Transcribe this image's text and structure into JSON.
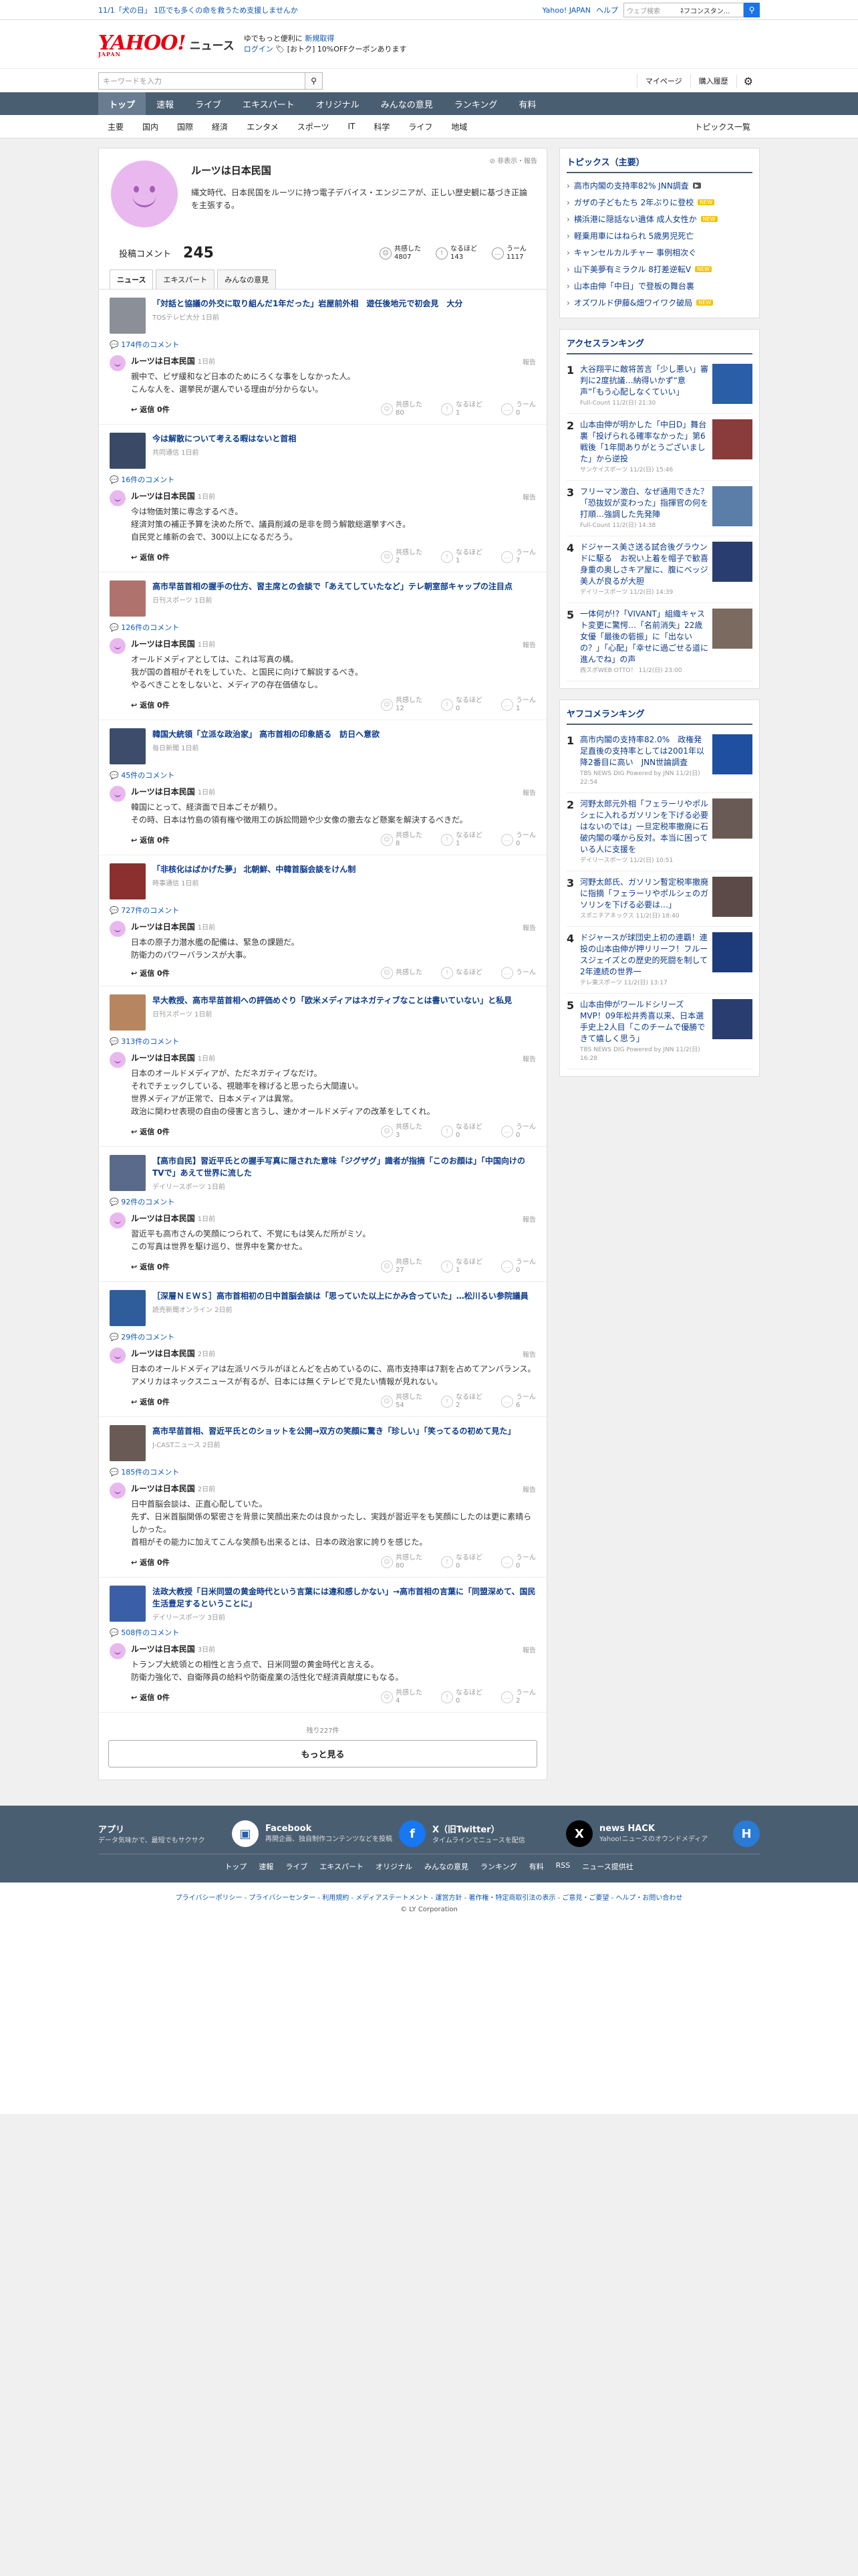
{
  "topstrip": {
    "notice": "11/1「犬の日」 1匹でも多くの命を救うため支援しませんか",
    "links": [
      "Yahoo! JAPAN",
      "ヘルプ"
    ],
    "search_placeholder": "ウェブ検索",
    "search_keyword": "ﾈフコンスタン..."
  },
  "header": {
    "logo_text": "YAHOO!",
    "logo_sub": "JAPAN",
    "section": "ニュース",
    "promo_line1": "ゆでもっと便利に",
    "promo_line1_link": "新規取得",
    "promo_line2_link": "ログイン",
    "promo_line2_text": "[おトク] 10%OFFクーポンあります"
  },
  "searchbar": {
    "placeholder": "キーワードを入力",
    "util": [
      "マイページ",
      "購入履歴"
    ]
  },
  "nav": [
    "トップ",
    "速報",
    "ライブ",
    "エキスパート",
    "オリジナル",
    "みんなの意見",
    "ランキング",
    "有料"
  ],
  "subnav": {
    "items": [
      "主要",
      "国内",
      "国際",
      "経済",
      "エンタメ",
      "スポーツ",
      "IT",
      "科学",
      "ライフ",
      "地域"
    ],
    "topics": "トピックス一覧"
  },
  "profile": {
    "name": "ルーツは日本民国",
    "bio": "縄文時代、日本民国をルーツに持つ電子デバイス・エンジニアが、正しい歴史観に基づき正論を主張する。",
    "report": "非表示・報告",
    "comment_label": "投稿コメント",
    "comment_count": "245",
    "reactions": [
      {
        "label": "共感した",
        "value": "4807"
      },
      {
        "label": "なるほど",
        "value": "143"
      },
      {
        "label": "うーん",
        "value": "1117"
      }
    ],
    "tabs": [
      "ニュース",
      "エキスパート",
      "みんなの意見"
    ]
  },
  "comments": [
    {
      "title": "「対話と協議の外交に取り組んだ1年だった」岩屋前外相　遊任後地元で初会見　大分",
      "source": "TOSテレビ大分 1日前",
      "count": "174件のコメント",
      "name": "ルーツは日本民国",
      "time": "1日前",
      "text": "親中で、ビザ緩和など日本のためにろくな事をしなかった人。\nこんな人を、選挙民が選んでいる理由が分からない。",
      "r": [
        "80",
        "1",
        "0"
      ]
    },
    {
      "title": "今は解散について考える暇はないと首相",
      "source": "共同通信 1日前",
      "count": "16件のコメント",
      "name": "ルーツは日本民国",
      "time": "1日前",
      "text": "今は物価対策に専念するべき。\n経済対策の補正予算を決めた所で、議員削減の是非を問う解散総選挙すべき。\n自民党と維新の会で、300以上になるだろう。",
      "r": [
        "2",
        "1",
        "7"
      ]
    },
    {
      "title": "高市早苗首相の握手の仕方、習主席との会談で「あえてしていたなど」テレ朝室部キャップの注目点",
      "source": "日刊スポーツ 1日前",
      "count": "126件のコメント",
      "name": "ルーツは日本民国",
      "time": "1日前",
      "text": "オールドメディアとしては、これは写真の構。\n我が国の首相がそれをしていた、と国民に向けて解説するべき。\nやるべきことをしないと、メディアの存在価値なし。",
      "r": [
        "12",
        "0",
        "1"
      ]
    },
    {
      "title": "韓国大統領「立派な政治家」 高市首相の印象語る　訪日へ意欲",
      "source": "毎日新聞 1日前",
      "count": "45件のコメント",
      "name": "ルーツは日本民国",
      "time": "1日前",
      "text": "韓国にとって、経済面で日本ごそが頼り。\nその時、日本は竹島の領有権や徴用工の訴訟問題や少女像の撤去など懸案を解決するべきだ。",
      "r": [
        "8",
        "1",
        "0"
      ]
    },
    {
      "title": "「非核化はばかげた夢」 北朝鮮、中韓首脳会談をけん制",
      "source": "時事通信 1日前",
      "count": "727件のコメント",
      "name": "ルーツは日本民国",
      "time": "1日前",
      "text": "日本の原子力潜水艦の配備は、緊急の課題だ。\n防衛力のパワーバランスが大事。",
      "r": [
        "",
        "",
        ""
      ]
    },
    {
      "title": "早大教授、高市早苗首相への評価めぐり「欧米メディアはネガティブなことは書いていない」と私見",
      "source": "日刊スポーツ 1日前",
      "count": "313件のコメント",
      "name": "ルーツは日本民国",
      "time": "1日前",
      "text": "日本のオールドメディアが、ただネガティブなだけ。\nそれでチェックしている、視聴率を稼げると思ったら大間違い。\n世界メディアが正常で、日本メディアは異常。\n政治に関わせ表現の自由の侵害と言うし、速かオールドメディアの改革をしてくれ。",
      "r": [
        "3",
        "0",
        "0"
      ]
    },
    {
      "title": "【高市自民】習近平氏との握手写真に隠された意味「ジグザグ」識者が指摘「このお顔は」「中国向けのTVで」あえて世界に流した",
      "source": "デイリースポーツ 1日前",
      "count": "92件のコメント",
      "name": "ルーツは日本民国",
      "time": "1日前",
      "text": "習近平も高市さんの笑顔につられて、不覚にもは笑んだ所がミソ。\nこの写真は世界を駆け巡り、世界中を驚かせた。",
      "r": [
        "27",
        "1",
        "0"
      ]
    },
    {
      "title": "［深層ＮＥＷＳ］高市首相初の日中首脳会談は「思っていた以上にかみ合っていた」…松川るい参院議員",
      "source": "読売新聞オンライン 2日前",
      "count": "29件のコメント",
      "name": "ルーツは日本民国",
      "time": "2日前",
      "text": "日本のオールドメディアは左派リベラルがほとんどを占めているのに、高市支持率は7割を占めてアンバランス。\nアメリカはネックスニュースが有るが、日本には無くテレビで見たい情報が見れない。",
      "r": [
        "54",
        "2",
        "6"
      ]
    },
    {
      "title": "高市早苗首相、習近平氏とのショットを公開→双方の笑顔に驚き「珍しい」「笑ってるの初めて見た」",
      "source": "J-CASTニュース 2日前",
      "count": "185件のコメント",
      "name": "ルーツは日本民国",
      "time": "2日前",
      "text": "日中首脳会談は、正直心配していた。\n先ず、日米首脳関係の緊密さを背景に笑顔出来たのは良かったし、実践が習近平をも笑顔にしたのは更に素晴らしかった。\n首相がその能力に加えてこんな笑顔も出来るとは、日本の政治家に誇りを感じた。",
      "r": [
        "80",
        "0",
        "0"
      ]
    },
    {
      "title": "法政大教授「日米同盟の黄金時代という言葉には違和感しかない」→高市首相の言葉に「同盟深めて、国民生活豊足するということに」",
      "source": "デイリースポーツ 3日前",
      "count": "508件のコメント",
      "name": "ルーツは日本民国",
      "time": "3日前",
      "text": "トランプ大統領との相性と言う点で、日米同盟の黄金時代と言える。\n防衛力強化で、自衛隊員の給料や防衛産業の活性化で経済貢献度にもなる。",
      "r": [
        "4",
        "0",
        "2"
      ]
    }
  ],
  "labels": {
    "reply": "返信 0件",
    "report": "報告",
    "react": [
      "共感した",
      "なるほど",
      "うーん"
    ]
  },
  "more": {
    "rest": "残り227件",
    "button": "もっと見る"
  },
  "sidebar": {
    "topics_title": "トピックス（主要）",
    "topics": [
      {
        "text": "高市内閣の支持率82% JNN調査",
        "tag": "v"
      },
      {
        "text": "ガザの子どもたち 2年ぶりに登校",
        "tag": "new"
      },
      {
        "text": "横浜港に隠話ない遺体 成人女性か",
        "tag": "new"
      },
      {
        "text": "軽乗用車にはねられ 5歳男児死亡",
        "tag": ""
      },
      {
        "text": "キャンセルカルチャー 事例相次ぐ",
        "tag": ""
      },
      {
        "text": "山下美夢有ミラクル 8打差逆転V",
        "tag": "new"
      },
      {
        "text": "山本由伸「中日」で登板の舞台裏",
        "tag": ""
      },
      {
        "text": "オズワルド伊藤&畑ワイワク破局",
        "tag": "new"
      }
    ],
    "access_title": "アクセスランキング",
    "access": [
      {
        "t": "大谷翔平に敵将苦言「少し悪い」審判に2度抗議…納得いかず“意声”「もう心配しなくていい」",
        "s": "Full-Count 11/2(日) 21:30"
      },
      {
        "t": "山本由伸が明かした「中日D」舞台裏「投げられる確率なかった」第6戦後「1年間ありがとうございました」から逆投",
        "s": "サンケイスポーツ 11/2(日) 15:46"
      },
      {
        "t": "フリーマン激白、なぜ通用できた？「恐抜奴が変わった」指揮官の何を打順…強調した先発陣",
        "s": "Full-Count 11/2(日) 14:38"
      },
      {
        "t": "ドジャース美さ送る試合後グラウンドに駆る　お祝い上着を帽子で歓喜　身重の奥しさキア屋に、腹にベッジ美人が良るが大胆",
        "s": "デイリースポーツ 11/2(日) 14:39"
      },
      {
        "t": "一体何が!?「VIVANT」組織キャスト変更に驚愕…「名前消失」22歳女優「最後の砦振」に「出ないの？」「心配」「幸せに過ごせる道に進んでね」の声",
        "s": "西スポWEB OTTO！ 11/2(日) 23:00"
      }
    ],
    "yafoko_title": "ヤフコメランキング",
    "yafoko": [
      {
        "t": "高市内閣の支持率82.0%　政権発足直後の支持率としては2001年以降2番目に高い　JNN世論調査",
        "s": "TBS NEWS DIG Powered by JNN 11/2(日) 22:54"
      },
      {
        "t": "河野太郎元外相「フェラーリやポルシェに入れるガソリンを下げる必要はないのでは」一旦定税率撤廃に石破内閣の嘆から反対。本当に困っている人に支援を",
        "s": "デイリースポーツ 11/2(日) 10:51"
      },
      {
        "t": "河野太郎氏、ガソリン暫定税率撤廃に指摘「フェラーリやポルシェのガソリンを下げる必要は…」",
        "s": "スポニチアネックス 11/2(日) 18:40"
      },
      {
        "t": "ドジャースが球団史上初の連覇！連投の山本由伸が押リリーフ！フルースジェイズとの歴史的死闘を制して2年連続の世界一",
        "s": "テレ東スポーツ 11/2(日) 13:17"
      },
      {
        "t": "山本由伸がワールドシリーズMVP！09年松井秀喜以来、日本選手史上2人目「このチームで優勝できて嬉しく思う」",
        "s": "TBS NEWS DIG Powered by JNN 11/2(日) 16:28"
      }
    ]
  },
  "footer": {
    "cards": [
      {
        "title": "アプリ",
        "desc": "データ気味かで、最短でもサクサク",
        "icon": "▣"
      },
      {
        "title": "Facebook",
        "desc": "再開企画、独自制作コンテンツなどを投稿",
        "icon": "f"
      },
      {
        "title": "X（旧Twitter）",
        "desc": "タイムラインでニュースを配信",
        "icon": "X"
      },
      {
        "title": "news HACK",
        "desc": "Yahoo!ニュースのオウンドメディア",
        "icon": "H"
      }
    ],
    "nav": [
      "トップ",
      "速報",
      "ライブ",
      "エキスパート",
      "オリジナル",
      "みんなの意見",
      "ランキング",
      "有料",
      "RSS",
      "ニュース提供社"
    ],
    "links": "プライバシーポリシー - プライバシーセンター - 利用規約 - メディアステートメント - 運営方針 - 著作権・特定商取引法の表示 - ご意見・ご要望 - ヘルプ・お問い合わせ",
    "copy": "© LY Corporation"
  },
  "colors": {
    "nav_bg": "#4a5e72",
    "link": "#0b3a8a",
    "avatar": "#e9b8ef"
  }
}
